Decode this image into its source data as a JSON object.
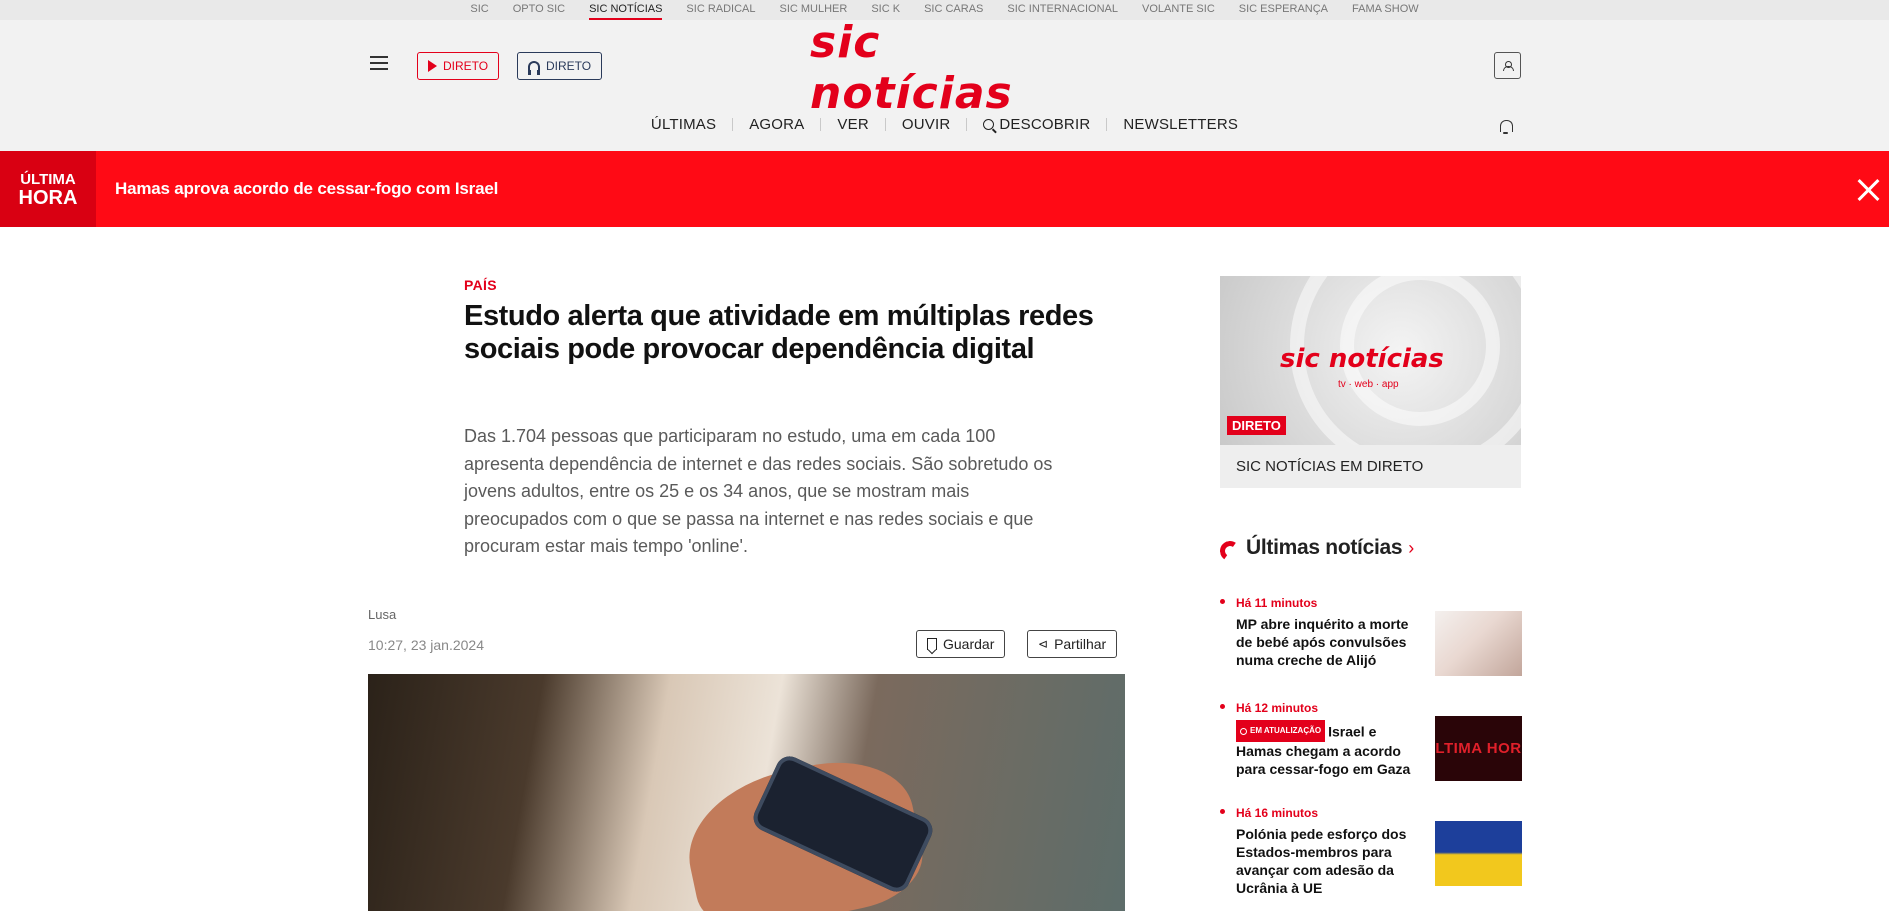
{
  "network": [
    "SIC",
    "OPTO SIC",
    "SIC NOTÍCIAS",
    "SIC RADICAL",
    "SIC MULHER",
    "SIC K",
    "SIC CARAS",
    "SIC INTERNACIONAL",
    "VOLANTE SIC",
    "SIC ESPERANÇA",
    "FAMA SHOW"
  ],
  "header": {
    "logo": "sic notícias",
    "direto_tv": "DIRETO",
    "direto_radio": "DIRETO",
    "nav": [
      "ÚLTIMAS",
      "AGORA",
      "VER",
      "OUVIR",
      "DESCOBRIR",
      "NEWSLETTERS"
    ]
  },
  "breaking": {
    "tag_line1": "ÚLTIMA",
    "tag_line2": "HORA",
    "headline": "Hamas aprova acordo de cessar-fogo com Israel"
  },
  "article": {
    "section": "PAÍS",
    "title": "Estudo alerta que atividade em múltiplas redes sociais pode provocar dependência digital",
    "lead": "Das 1.704 pessoas que participaram no estudo, uma em cada 100 apresenta dependência de internet e das redes sociais. São sobretudo os jovens adultos, entre os 25 e os 34 anos, que se mostram mais preocupados com o que se passa na internet e nas redes sociais e que procuram estar mais tempo 'online'.",
    "author": "Lusa",
    "date": "10:27, 23 jan.2024",
    "save": "Guardar",
    "share": "Partilhar"
  },
  "live": {
    "logo": "sic notícias",
    "sub": "tv · web · app",
    "badge": "DIRETO",
    "title": "SIC NOTÍCIAS EM DIRETO"
  },
  "latest": {
    "heading": "Últimas notícias",
    "items": [
      {
        "time": "Há 11 minutos",
        "title": "MP abre inquérito a morte de bebé após convulsões numa creche de Alijó"
      },
      {
        "time": "Há 12 minutos",
        "badge": "EM ATUALIZAÇÃO",
        "title": "Israel e Hamas chegam a acordo para cessar-fogo em Gaza",
        "thumb_text": "ÚLTIMA HORA"
      },
      {
        "time": "Há 16 minutos",
        "title": "Polónia pede esforço dos Estados-membros para avançar com adesão da Ucrânia à UE"
      }
    ]
  },
  "colors": {
    "brand": "#e3001b",
    "breaking_bg": "#ff0a15"
  }
}
